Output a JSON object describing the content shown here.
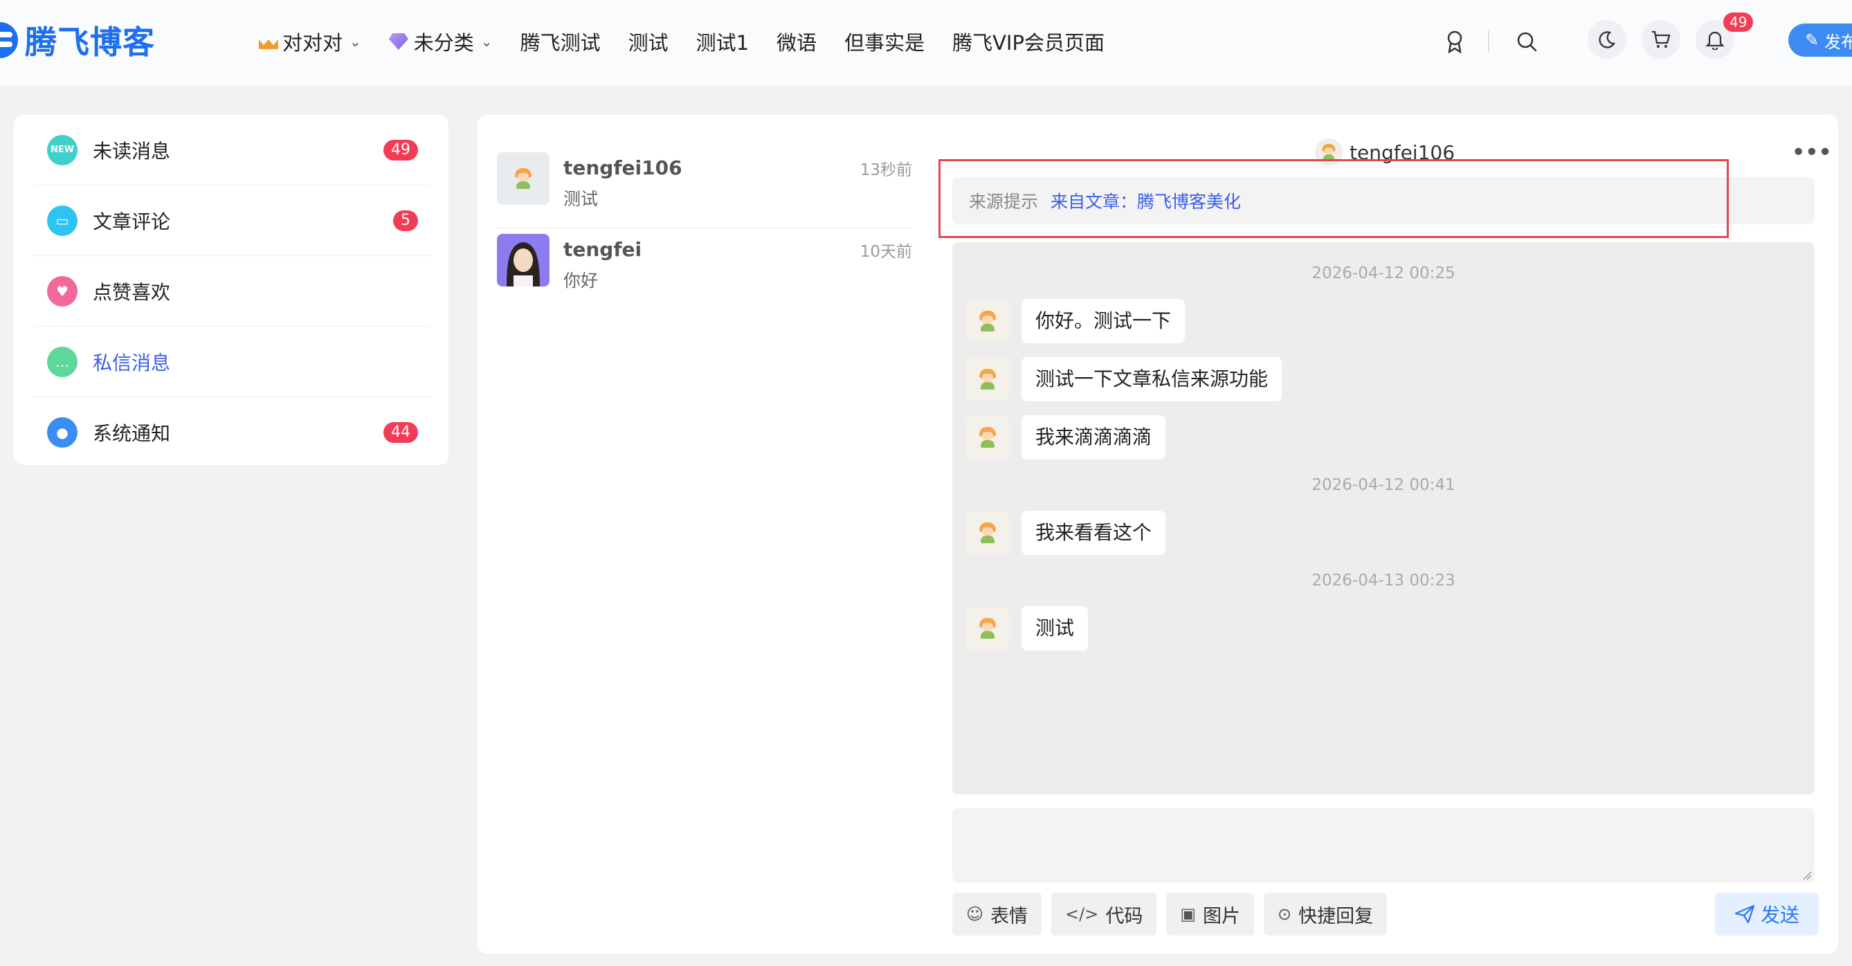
{
  "header": {
    "logo_text": "腾飞博客",
    "nav": [
      {
        "label": "对对对",
        "icon": "crown-icon",
        "has_dropdown": true
      },
      {
        "label": "未分类",
        "icon": "gem-icon",
        "has_dropdown": true
      },
      {
        "label": "腾飞测试"
      },
      {
        "label": "测试"
      },
      {
        "label": "测试1"
      },
      {
        "label": "微语"
      },
      {
        "label": "但事实是"
      },
      {
        "label": "腾飞VIP会员页面"
      }
    ],
    "notification_count": "49",
    "publish_label": "发布"
  },
  "sidebar": {
    "items": [
      {
        "label": "未读消息",
        "count": "49",
        "icon": "new-message-icon",
        "color": "#3fd0c9"
      },
      {
        "label": "文章评论",
        "count": "5",
        "icon": "comment-icon",
        "color": "#2ec3f2"
      },
      {
        "label": "点赞喜欢",
        "count": "",
        "icon": "heart-icon",
        "color": "#f2689b"
      },
      {
        "label": "私信消息",
        "count": "",
        "icon": "chat-bubble-icon",
        "color": "#5fd69a",
        "active": true
      },
      {
        "label": "系统通知",
        "count": "44",
        "icon": "bell-icon",
        "color": "#3a8df2"
      }
    ]
  },
  "conversations": [
    {
      "name": "tengfei106",
      "last_message": "测试",
      "time": "13秒前"
    },
    {
      "name": "tengfei",
      "last_message": "你好",
      "time": "10天前"
    }
  ],
  "chat": {
    "partner_name": "tengfei106",
    "source_label": "来源提示",
    "source_link": "来自文章：腾飞博客美化",
    "groups": [
      {
        "time": "2026-04-12 00:25",
        "messages": [
          "你好。测试一下",
          "测试一下文章私信来源功能",
          "我来滴滴滴滴"
        ]
      },
      {
        "time": "2026-04-12 00:41",
        "messages": [
          "我来看看这个"
        ]
      },
      {
        "time": "2026-04-13 00:23",
        "messages": [
          "测试"
        ]
      }
    ],
    "toolbar": [
      {
        "label": "表情",
        "icon": "smiley-icon"
      },
      {
        "label": "代码",
        "icon": "code-icon"
      },
      {
        "label": "图片",
        "icon": "image-icon"
      },
      {
        "label": "快捷回复",
        "icon": "quick-reply-icon"
      }
    ],
    "send_label": "发送"
  },
  "colors": {
    "brand": "#1e6ff0",
    "active_link": "#3a5ee8",
    "badge": "#f23b55",
    "highlight_frame": "#e2474c"
  }
}
